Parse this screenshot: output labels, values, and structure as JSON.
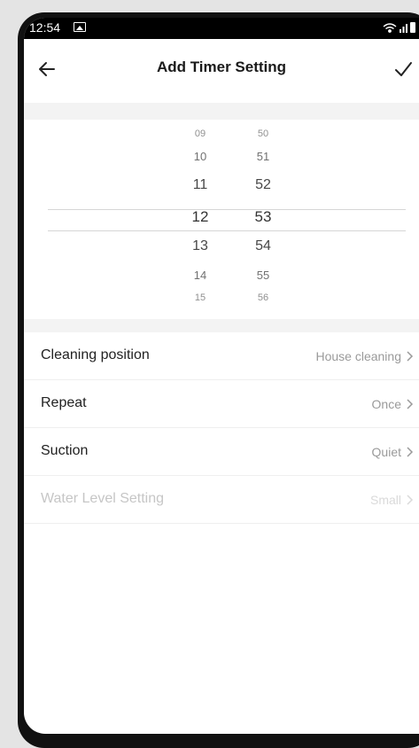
{
  "status_bar": {
    "time": "12:54",
    "icons": [
      "image-icon",
      "wifi-icon",
      "signal-icon",
      "battery-icon"
    ]
  },
  "header": {
    "title": "Add Timer Setting",
    "back_icon": "arrow-left-icon",
    "confirm_icon": "check-icon"
  },
  "picker": {
    "hours": [
      "09",
      "10",
      "11",
      "12",
      "13",
      "14",
      "15"
    ],
    "minutes": [
      "50",
      "51",
      "52",
      "53",
      "54",
      "55",
      "56"
    ],
    "selected_hour": "12",
    "selected_minute": "53"
  },
  "settings": [
    {
      "label": "Cleaning position",
      "value": "House cleaning",
      "enabled": true
    },
    {
      "label": "Repeat",
      "value": "Once",
      "enabled": true
    },
    {
      "label": "Suction",
      "value": "Quiet",
      "enabled": true
    },
    {
      "label": "Water Level Setting",
      "value": "Small",
      "enabled": false
    }
  ],
  "colors": {
    "background": "#ffffff",
    "section_gray": "#f3f3f3",
    "text_primary": "#222222",
    "text_secondary": "#9a9a9a",
    "text_disabled": "#c6c6c6"
  }
}
